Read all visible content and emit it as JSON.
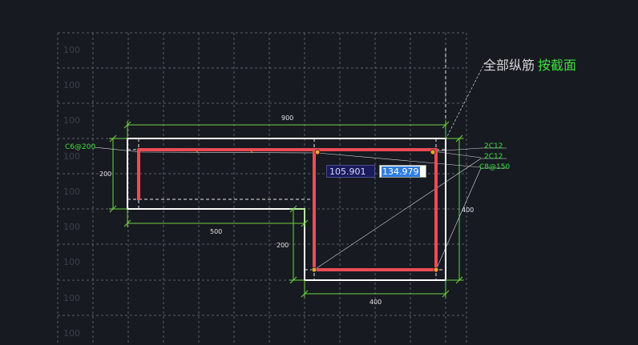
{
  "grid": {
    "row_labels": [
      "100",
      "100",
      "100",
      "100",
      "100",
      "100",
      "100",
      "100",
      "100"
    ]
  },
  "command_prompt": {
    "text": "全部纵筋",
    "option": "按截面"
  },
  "dimensions": {
    "top_width": "900",
    "left_height": "200",
    "lower_width": "500",
    "step_height": "200",
    "right_height": "400",
    "bottom_width": "400"
  },
  "rebar_labels": {
    "left_stirrup": "C6@200",
    "right_top_1": "2C12",
    "right_top_2": "2C12",
    "right_stirrup": "C8@150"
  },
  "coordinate_input": {
    "x_value": "105.901",
    "y_value": "134.979"
  },
  "colors": {
    "background": "#171a21",
    "grid": "#5b5f66",
    "section_outline": "#ffffff",
    "rebar": "#ef4b55",
    "dimension": "#6fd243",
    "label_green": "#3ee13e",
    "rebar_node": "#f0a030"
  }
}
